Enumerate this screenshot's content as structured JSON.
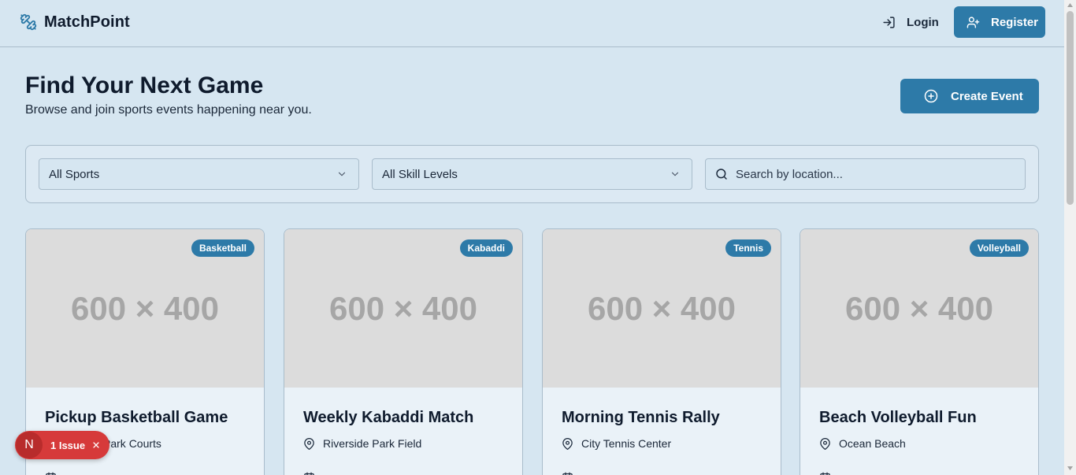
{
  "header": {
    "brand": "MatchPoint",
    "login_label": "Login",
    "register_label": "Register"
  },
  "hero": {
    "title": "Find Your Next Game",
    "subtitle": "Browse and join sports events happening near you.",
    "create_label": "Create Event"
  },
  "filters": {
    "sport_selected": "All Sports",
    "skill_selected": "All Skill Levels",
    "search_placeholder": "Search by location..."
  },
  "events": [
    {
      "sport": "Basketball",
      "image_text": "600 × 400",
      "title": "Pickup Basketball Game",
      "location": "Central Park Courts"
    },
    {
      "sport": "Kabaddi",
      "image_text": "600 × 400",
      "title": "Weekly Kabaddi Match",
      "location": "Riverside Park Field"
    },
    {
      "sport": "Tennis",
      "image_text": "600 × 400",
      "title": "Morning Tennis Rally",
      "location": "City Tennis Center"
    },
    {
      "sport": "Volleyball",
      "image_text": "600 × 400",
      "title": "Beach Volleyball Fun",
      "location": "Ocean Beach"
    }
  ],
  "issues": {
    "avatar_letter": "N",
    "label": "1 Issue"
  },
  "colors": {
    "background": "#d6e6f1",
    "accent": "#2d7aa8",
    "issue": "#d63a3a"
  }
}
